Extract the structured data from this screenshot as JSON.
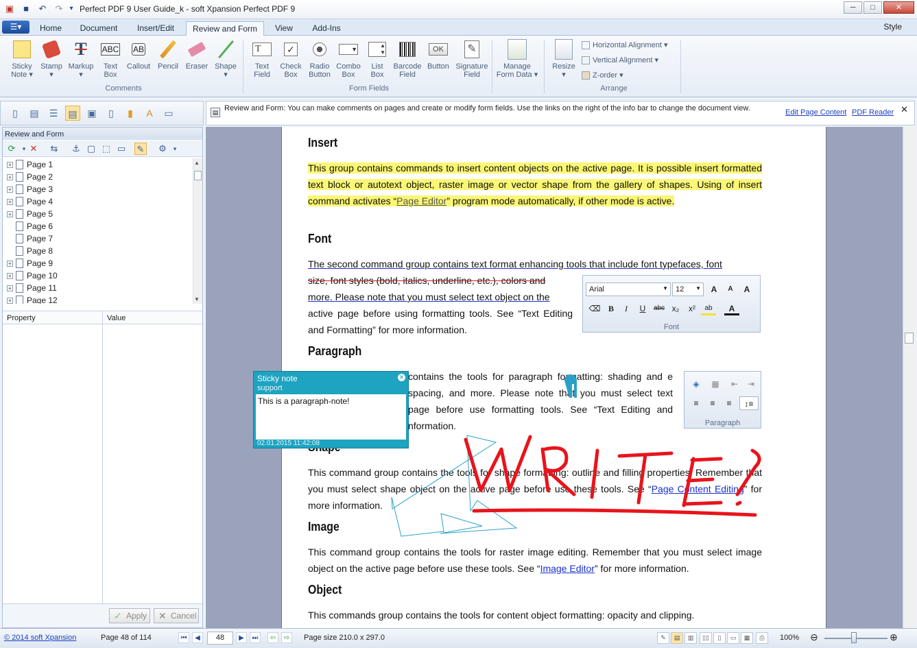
{
  "window": {
    "title": "Perfect PDF 9 User Guide_k - soft Xpansion Perfect PDF 9",
    "qat_icons": [
      "pdf-app-icon",
      "save-icon",
      "undo-icon",
      "redo-icon",
      "customize-icon"
    ],
    "controls": {
      "minimize": "─",
      "maximize": "□",
      "close": "✕"
    }
  },
  "ribbon": {
    "app_menu": "☰▾",
    "tabs": [
      "Home",
      "Document",
      "Insert/Edit",
      "Review and Form",
      "View",
      "Add-Ins"
    ],
    "active_tab": "Review and Form",
    "style_menu": "Style",
    "comments_group": {
      "label": "Comments",
      "buttons": [
        {
          "label": "Sticky\nNote ▾",
          "icon": "sticky-note-icon"
        },
        {
          "label": "Stamp\n▾",
          "icon": "stamp-icon"
        },
        {
          "label": "Markup\n▾",
          "icon": "markup-icon"
        },
        {
          "label": "Text\nBox",
          "icon": "text-box-icon"
        },
        {
          "label": "Callout",
          "icon": "callout-icon"
        },
        {
          "label": "Pencil",
          "icon": "pencil-icon"
        },
        {
          "label": "Eraser",
          "icon": "eraser-icon"
        },
        {
          "label": "Shape\n▾",
          "icon": "shape-icon"
        }
      ]
    },
    "form_fields_group": {
      "label": "Form Fields",
      "buttons": [
        {
          "label": "Text\nField",
          "icon": "text-field-icon"
        },
        {
          "label": "Check\nBox",
          "icon": "check-box-icon"
        },
        {
          "label": "Radio\nButton",
          "icon": "radio-button-icon"
        },
        {
          "label": "Combo\nBox",
          "icon": "combo-box-icon"
        },
        {
          "label": "List\nBox",
          "icon": "list-box-icon"
        },
        {
          "label": "Barcode\nField",
          "icon": "barcode-icon"
        },
        {
          "label": "Button",
          "icon": "button-field-icon"
        },
        {
          "label": "Signature\nField",
          "icon": "signature-icon"
        }
      ],
      "manage": {
        "label": "Manage\nForm Data ▾",
        "icon": "manage-form-data-icon"
      }
    },
    "arrange_group": {
      "label": "Arrange",
      "resize": "Resize\n▾",
      "horizontal_alignment": "Horizontal Alignment ▾",
      "vertical_alignment": "Vertical Alignment ▾",
      "z_order": "Z-order ▾"
    }
  },
  "info_bar": {
    "text": "Review and Form: You can make comments on pages and create or modify form fields. Use the links on the right of the info bar to change the document view.",
    "link_edit": "Edit Page Content",
    "link_reader": "PDF Reader",
    "close": "✕"
  },
  "left_panel": {
    "title": "Review and Form",
    "tree_pages": [
      "Page 1",
      "Page 2",
      "Page 3",
      "Page 4",
      "Page 5",
      "Page 6",
      "Page 7",
      "Page 8",
      "Page 9",
      "Page 10",
      "Page 11",
      "Page 12"
    ],
    "tree_expandable": [
      true,
      true,
      true,
      true,
      true,
      false,
      false,
      false,
      true,
      true,
      true,
      true
    ],
    "property_col": "Property",
    "value_col": "Value",
    "apply": "Apply",
    "cancel": "Cancel"
  },
  "document": {
    "h_insert": "Insert",
    "p_insert_1": "This group contains commands to insert content objects on the active page. It is possible insert formatted text block or autotext object, raster image or vector shape from the gallery of shapes. Using of insert command activates “",
    "p_insert_link": "Page Editor",
    "p_insert_2": "” program mode automatically, if other mode is active.",
    "h_font": "Font",
    "p_font_1": "The second command group contains text format enhancing tools that include font typefaces, font",
    "p_font_strike": "size, font styles (bold, italics, underline, etc.), colors and",
    "p_font_2": "more. Please note that you must select text object on the",
    "p_font_3": "active page before using formatting tools. See “Text Editing and Formatting” for more information.",
    "font_toolbar": {
      "font": "Arial",
      "size": "12",
      "label": "Font"
    },
    "h_paragraph": "Paragraph",
    "p_paragraph": "contains the tools for paragraph formatting: shading and e spacing, and more. Please note that you must select text page before use formatting tools. See “Text Editing and nformation.",
    "paragraph_toolbar": {
      "label": "Paragraph"
    },
    "h_shape": "Shape",
    "p_shape_1": "This command group contains the tools for shape formatting: outline and filling properties. Remember that you must select shape object on the active page before use these tools. See “",
    "p_shape_link": "Page Content Editing",
    "p_shape_2": "” for more information.",
    "h_image": "Image",
    "p_image_1": "This command group contains the tools for raster image editing. Remember that you must select image object on the active page before use these tools. See “",
    "p_image_link": "Image Editor",
    "p_image_2": "” for more information.",
    "h_object": "Object",
    "p_object": "This commands group contains the tools for content object formatting: opacity and clipping."
  },
  "sticky_note": {
    "title": "Sticky note",
    "author": "support",
    "text": "This is a paragraph-note!",
    "date": "02.01.2015 11:42:08",
    "close": "✕"
  },
  "status_bar": {
    "copyright": "© 2014 soft Xpansion",
    "page_info": "Page 48 of 114",
    "page_number": "48",
    "page_size": "Page size 210.0 x 297.0",
    "zoom": "100%"
  },
  "colors": {
    "highlight": "#fbf774",
    "ink": "#e8141c",
    "sticky": "#1ea3c0",
    "star": "#2aa0c8"
  }
}
